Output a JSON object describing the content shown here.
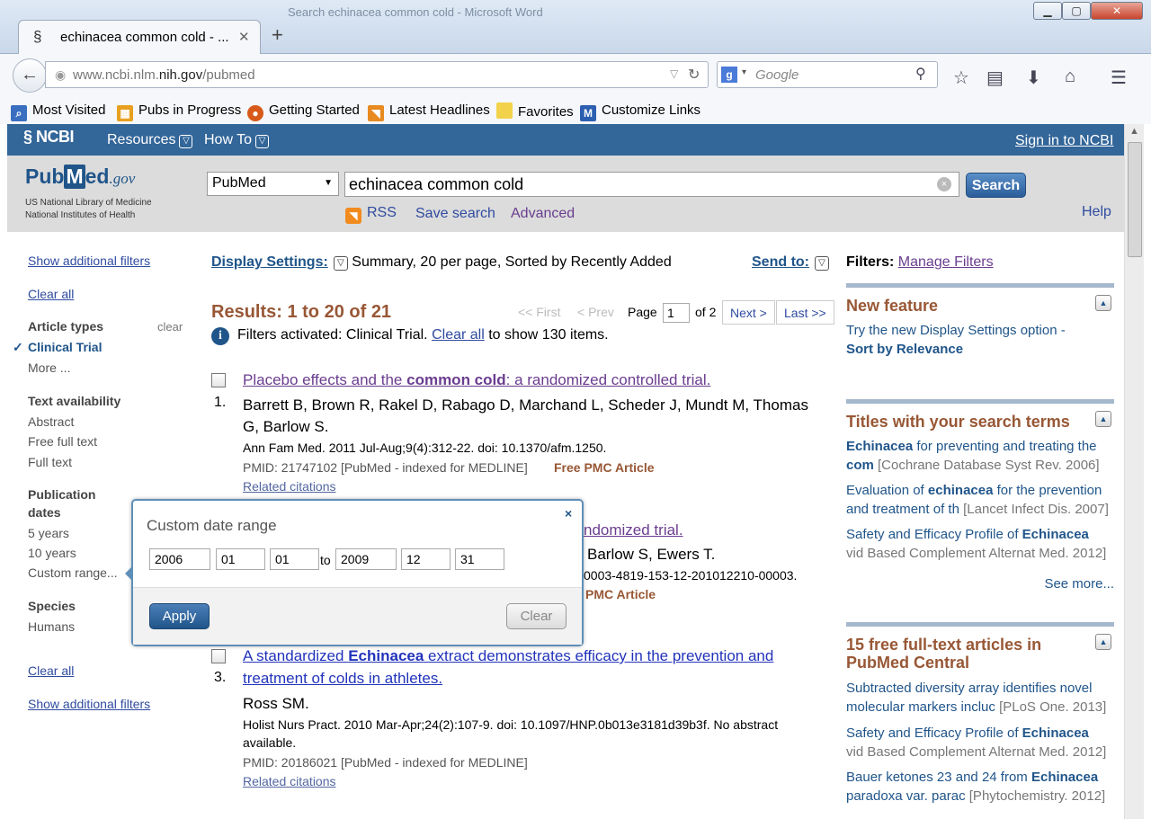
{
  "window": {
    "title": "Search echinacea common cold - Microsoft Word",
    "minimize_icon": "minimize-icon",
    "maximize_icon": "maximize-icon",
    "close_icon": "close-icon"
  },
  "tab": {
    "title": "echinacea common cold - ...",
    "close": "✕",
    "new_tab": "+"
  },
  "navbar": {
    "url_host_prefix": "www.ncbi.nlm.",
    "url_host_bold": "nih.gov",
    "url_path": "/pubmed",
    "search_engine": "g",
    "search_placeholder": "Google"
  },
  "bookmarks": [
    {
      "label": "Most Visited",
      "icon": "most-visited-icon",
      "color": "#3a6fc0"
    },
    {
      "label": "Pubs in Progress",
      "icon": "pubs-icon",
      "color": "#e8a020"
    },
    {
      "label": "Getting Started",
      "icon": "firefox-icon",
      "color": "#d85a1a"
    },
    {
      "label": "Latest Headlines",
      "icon": "rss-icon",
      "color": "#e88a20"
    },
    {
      "label": "Favorites",
      "icon": "folder-icon",
      "color": "#f2d24a"
    },
    {
      "label": "Customize Links",
      "icon": "m-icon",
      "color": "#2d5fb0"
    }
  ],
  "ncbi": {
    "logo": "NCBI",
    "resources": "Resources",
    "howto": "How To",
    "signin": "Sign in to NCBI"
  },
  "header": {
    "logo_pub": "Pub",
    "logo_m": "M",
    "logo_ed": "ed",
    "logo_gov": ".gov",
    "nlm1": "US National Library of Medicine",
    "nlm2": "National Institutes of Health",
    "database": "PubMed",
    "query": "echinacea common cold",
    "search_btn": "Search",
    "rss": "RSS",
    "save_search": "Save search",
    "advanced": "Advanced",
    "help": "Help"
  },
  "sidebar": {
    "show_filters_top": "Show additional filters",
    "clear_all_top": "Clear all",
    "article_types": "Article types",
    "clear": "clear",
    "clinical_trial": "Clinical Trial",
    "more": "More ...",
    "text_availability": "Text availability",
    "abstract": "Abstract",
    "free_full_text": "Free full text",
    "full_text": "Full text",
    "pub_dates_1": "Publication",
    "pub_dates_2": "dates",
    "five_years": "5 years",
    "ten_years": "10 years",
    "custom_range": "Custom range...",
    "species": "Species",
    "humans": "Humans",
    "clear_all_bottom": "Clear all",
    "show_filters_bottom": "Show additional filters"
  },
  "main": {
    "display_settings": "Display Settings:",
    "display_value": "Summary, 20 per page, Sorted by Recently Added",
    "send_to": "Send to:",
    "results": "Results: 1 to 20 of 21",
    "first": "<< First",
    "prev": "< Prev",
    "page_label": "Page",
    "page_value": "1",
    "of": "of 2",
    "next": "Next >",
    "last": "Last >>",
    "filters_text": "Filters activated: Clinical Trial.",
    "filters_clear": "Clear all",
    "filters_suffix": "to show 130 items.",
    "items": [
      {
        "num": "1.",
        "title_a": "Placebo effects and the ",
        "title_b": "common cold",
        "title_c": ": a randomized controlled trial.",
        "authors": "Barrett B, Brown R, Rakel D, Rabago D, Marchand L, Scheder J, Mundt M, Thomas G, Barlow S.",
        "citation": "Ann Fam Med. 2011 Jul-Aug;9(4):312-22. doi: 10.1370/afm.1250.",
        "pmid": "PMID: 21747102 [PubMed - indexed for MEDLINE]",
        "free": "Free PMC Article",
        "related": "Related citations"
      },
      {
        "title_tail": "ndomized trial.",
        "authors_tail": "Barlow S, Ewers T.",
        "citation_tail": "0003-4819-153-12-201012210-00003.",
        "free_tail": "PMC Article"
      },
      {
        "num": "3.",
        "title_a": "A standardized ",
        "title_b": "Echinacea",
        "title_c": " extract demonstrates efficacy in the prevention and",
        "title_d": "treatment of colds in athletes.",
        "authors": "Ross SM.",
        "citation": "Holist Nurs Pract. 2010 Mar-Apr;24(2):107-9. doi: 10.1097/HNP.0b013e3181d39b3f. No abstract available.",
        "pmid": "PMID: 20186021 [PubMed - indexed for MEDLINE]",
        "related": "Related citations"
      }
    ]
  },
  "right": {
    "filters": "Filters:",
    "manage": "Manage Filters",
    "new_feature": "New feature",
    "nf_line1": "Try the new Display Settings option -",
    "nf_line2": "Sort by Relevance",
    "titles_hdr": "Titles with your search terms",
    "t1_a": "Echinacea",
    "t1_b": " for preventing and treating the",
    "t1_c": "com",
    "t1_src": "[Cochrane Database Syst Rev. 2006]",
    "t2_a": "Evaluation of ",
    "t2_b": "echinacea",
    "t2_c": " for the prevention",
    "t2_d": "and treatment of th",
    "t2_src": "[Lancet Infect Dis. 2007]",
    "t3_a": "Safety and Efficacy Profile of ",
    "t3_b": "Echinacea",
    "t3_c": "vid Based Complement Alternat Med. 2012]",
    "see_more": "See more...",
    "free_hdr_1": "15 free full-text articles in",
    "free_hdr_2": "PubMed Central",
    "f1_a": "Subtracted diversity array identifies novel",
    "f1_b": "molecular markers incluc",
    "f1_src": "[PLoS One. 2013]",
    "f2_a": "Safety and Efficacy Profile of ",
    "f2_b": "Echinacea",
    "f2_c": "vid Based Complement Alternat Med. 2012]",
    "f3_a": "Bauer ketones 23 and 24 from ",
    "f3_b": "Echinacea",
    "f3_c": "paradoxa var. parac",
    "f3_src": "[Phytochemistry. 2012]"
  },
  "popup": {
    "title": "Custom date range",
    "close": "×",
    "start_year": "2006",
    "start_month": "01",
    "start_day": "01",
    "to": "to",
    "end_year": "2009",
    "end_month": "12",
    "end_day": "31",
    "apply": "Apply",
    "clear": "Clear"
  }
}
